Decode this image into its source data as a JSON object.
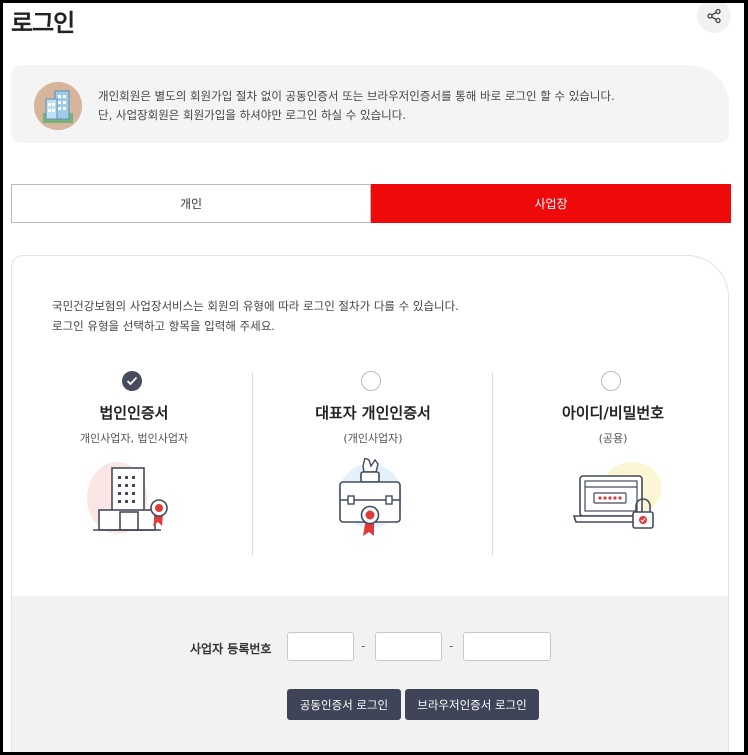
{
  "page": {
    "title": "로그인"
  },
  "share": {
    "icon": "share-icon"
  },
  "notice": {
    "icon": "building-icon",
    "line1": "개인회원은 별도의 회원가입 절차 없이 공동인증서 또는 브라우저인증서를 통해 바로 로그인 할 수 있습니다.",
    "line2": "단, 사업장회원은 회원가입을 하셔야만 로그인 하실 수 있습니다."
  },
  "tabs": [
    {
      "label": "개인",
      "active": false
    },
    {
      "label": "사업장",
      "active": true
    }
  ],
  "card": {
    "desc_line1": "국민건강보험의 사업장서비스는 회원의 유형에 따라 로그인 절차가 다를 수 있습니다.",
    "desc_line2": "로그인 유형을 선택하고 항목을 입력해 주세요."
  },
  "login_types": [
    {
      "title": "법인인증서",
      "subtitle": "개인사업자, 법인사업자",
      "selected": true,
      "icon": "office-building-certificate-icon"
    },
    {
      "title": "대표자 개인인증서",
      "subtitle": "(개인사업자)",
      "selected": false,
      "icon": "briefcase-certificate-icon"
    },
    {
      "title": "아이디/비밀번호",
      "subtitle": "(공용)",
      "selected": false,
      "icon": "laptop-password-lock-icon"
    }
  ],
  "form": {
    "biz_number_label": "사업자 등록번호",
    "biz_number_parts": [
      "",
      "",
      ""
    ],
    "separator": "-",
    "btn_joint_cert": "공동인증서 로그인",
    "btn_browser_cert": "브라우저인증서 로그인"
  },
  "colors": {
    "accent": "#ee0a0a",
    "dark_button": "#3f4458",
    "radio_selected": "#454a5c"
  }
}
